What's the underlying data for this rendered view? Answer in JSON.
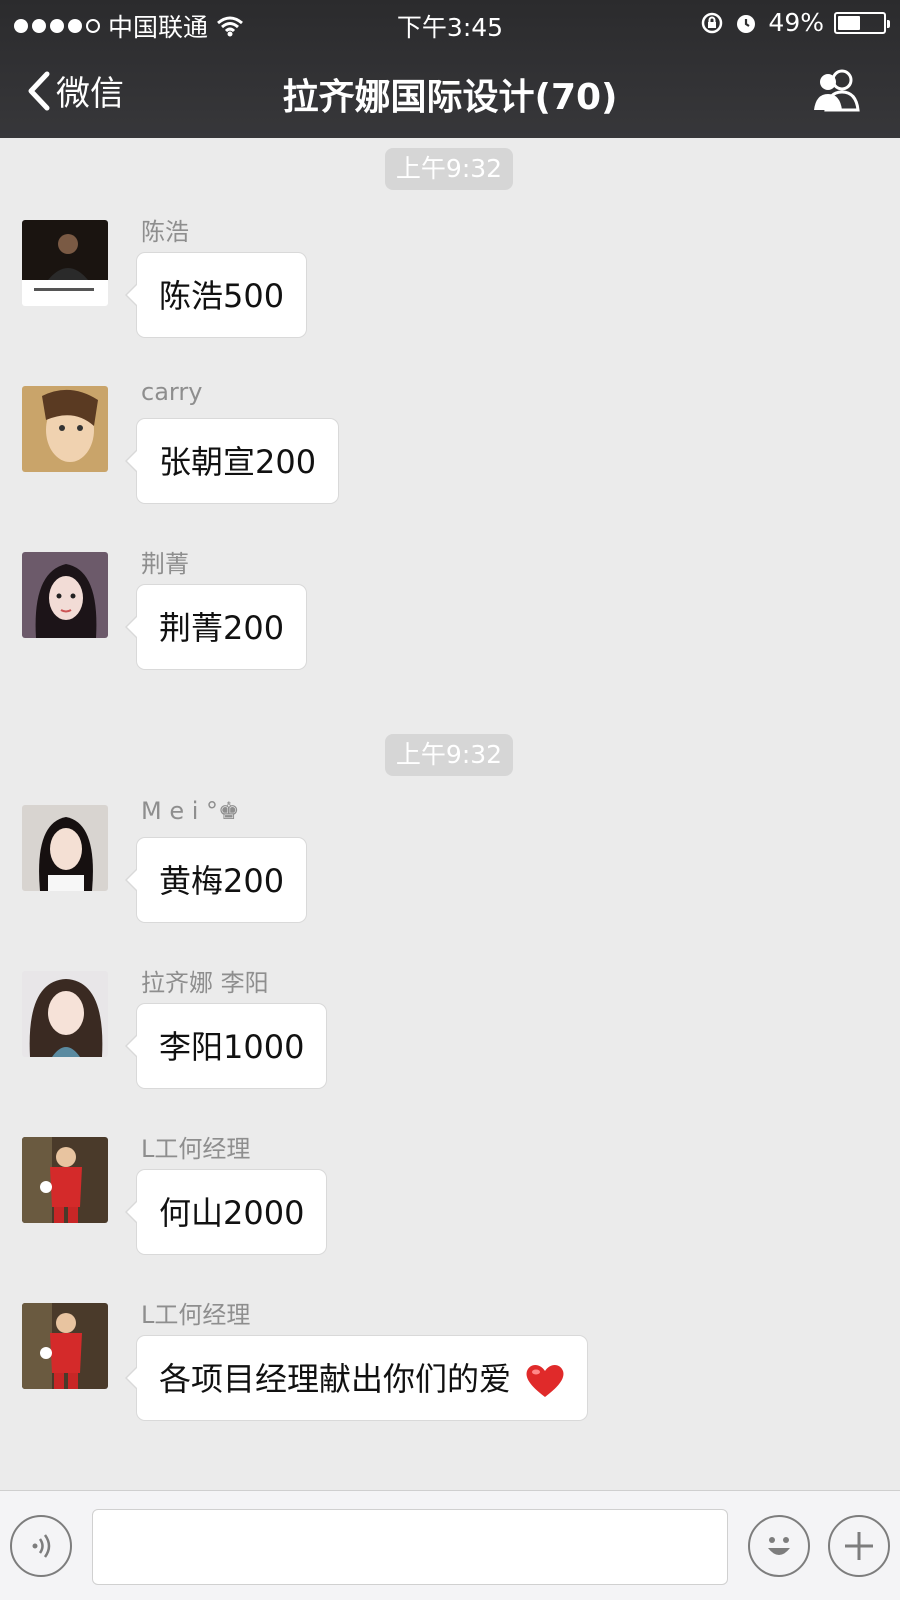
{
  "status_bar": {
    "carrier": "中国联通",
    "time": "下午3:45",
    "battery": "49%",
    "battery_level": 0.49
  },
  "nav": {
    "back_label": "微信",
    "title": "拉齐娜国际设计(70)"
  },
  "timestamps": [
    "上午9:32",
    "上午9:32"
  ],
  "messages": [
    {
      "sender": "陈浩",
      "text": "陈浩500"
    },
    {
      "sender": "carry",
      "text": "张朝宣200"
    },
    {
      "sender": "荆菁",
      "text": "荆菁200"
    },
    {
      "sender": "M e  i °♚",
      "text": "黄梅200"
    },
    {
      "sender": "拉齐娜 李阳",
      "text": "李阳1000"
    },
    {
      "sender": "L工何经理",
      "text": "何山2000"
    },
    {
      "sender": "L工何经理",
      "text": "各项目经理献出你们的爱"
    }
  ],
  "colors": {
    "header_bg": "#2e2e30",
    "chat_bg": "#ebebeb",
    "bubble_bg": "#ffffff",
    "heart": "#e02a2a"
  }
}
